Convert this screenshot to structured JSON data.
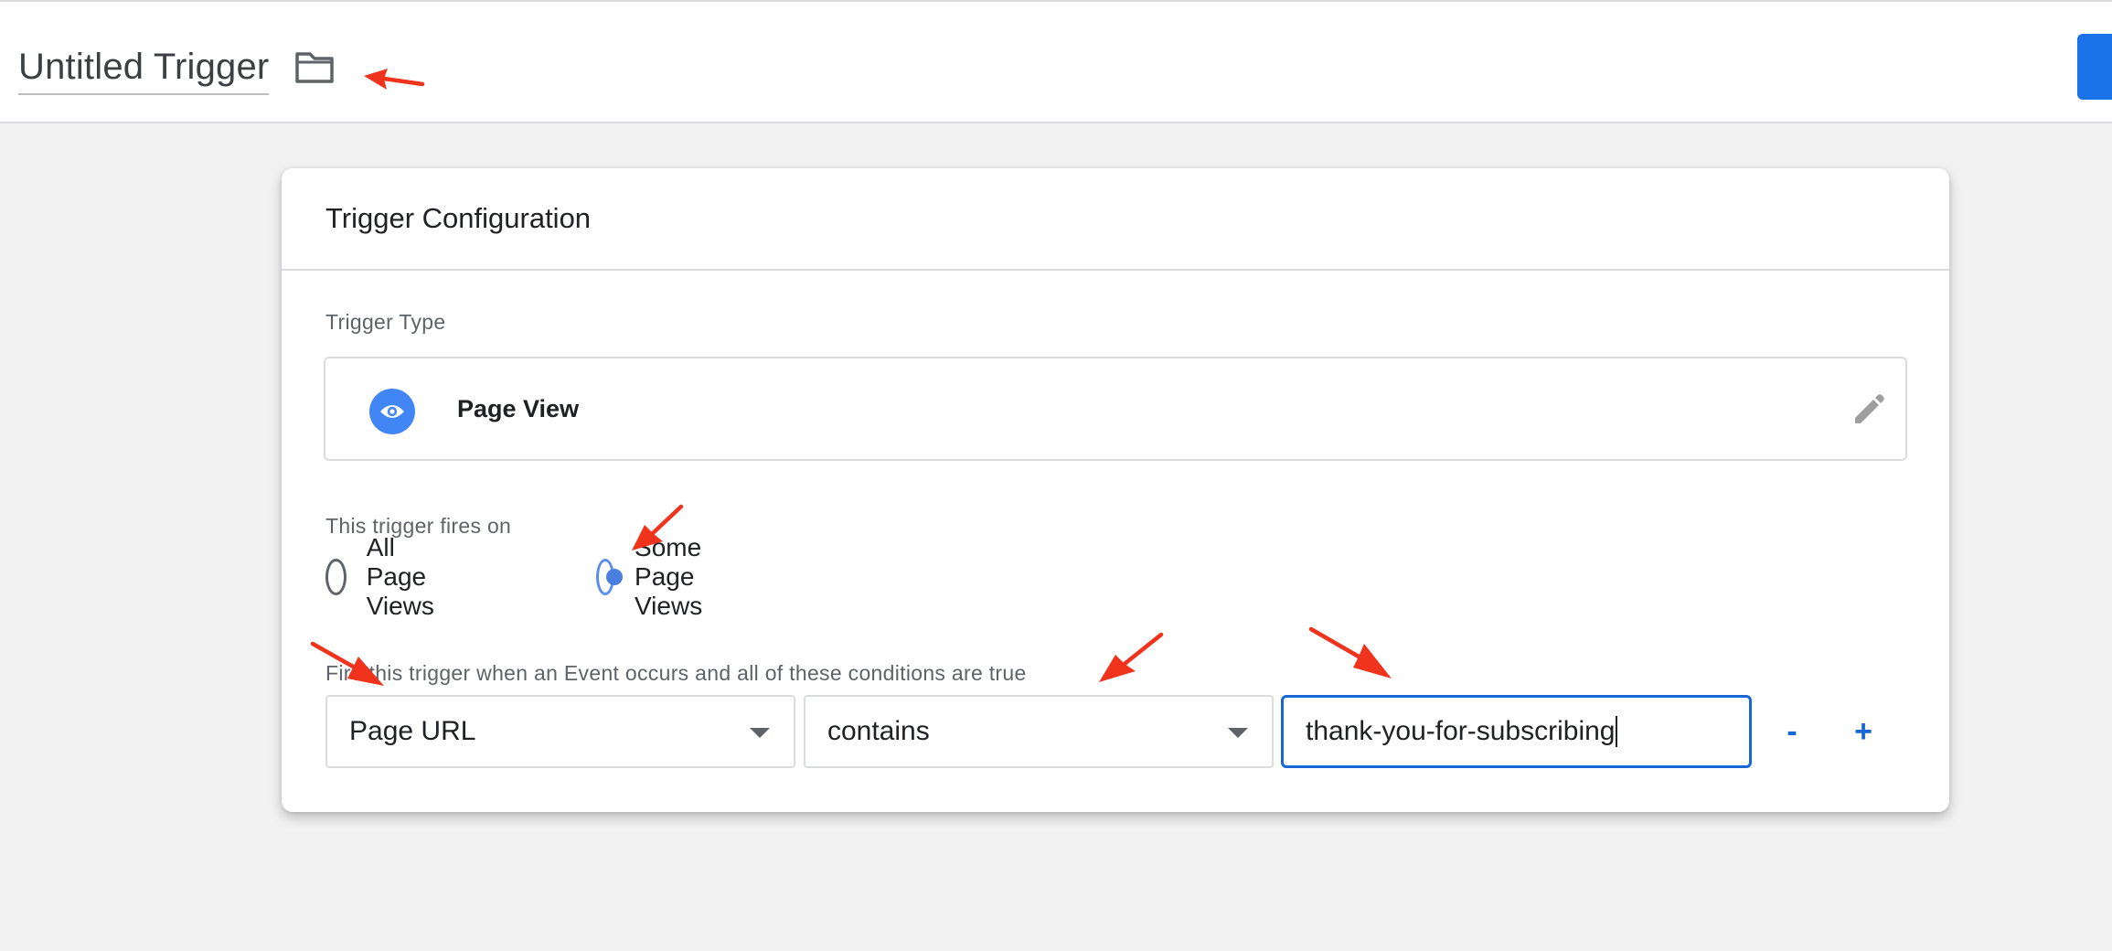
{
  "header": {
    "title": "Untitled Trigger",
    "folder_icon": "folder-icon",
    "save_button_color": "#1a73e8"
  },
  "card": {
    "title": "Trigger Configuration",
    "trigger_type_label": "Trigger Type",
    "trigger_type": {
      "name": "Page View",
      "icon": "eye-icon",
      "icon_color": "#4285f4",
      "edit_icon": "pencil-icon"
    },
    "fires_on_label": "This trigger fires on",
    "fires_on_options": [
      {
        "label": "All Page Views",
        "selected": false
      },
      {
        "label": "Some Page Views",
        "selected": true
      }
    ],
    "conditions_label": "Fire this trigger when an Event occurs and all of these conditions are true",
    "condition": {
      "variable": "Page URL",
      "operator": "contains",
      "value": "thank-you-for-subscribing"
    },
    "remove_label": "-",
    "add_label": "+"
  },
  "annotations": {
    "arrow_color": "#f0331c",
    "arrow_count": 6
  }
}
